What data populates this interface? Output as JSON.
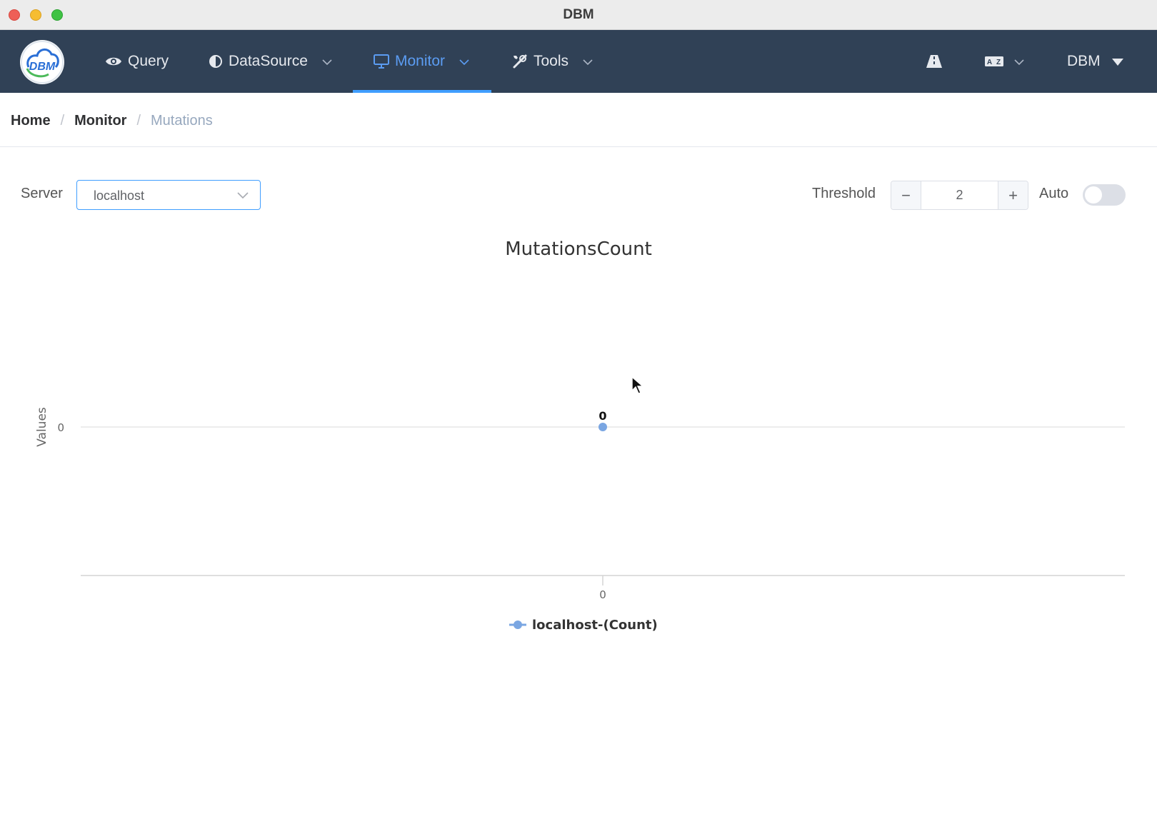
{
  "window": {
    "title": "DBM"
  },
  "nav": {
    "items": [
      {
        "label": "Query",
        "icon": "eye-icon"
      },
      {
        "label": "DataSource",
        "icon": "half-circle-icon"
      },
      {
        "label": "Monitor",
        "icon": "monitor-icon"
      },
      {
        "label": "Tools",
        "icon": "tools-icon"
      }
    ],
    "active": "Monitor",
    "logo_text": "DBM",
    "user_label": "DBM"
  },
  "breadcrumb": [
    "Home",
    "Monitor",
    "Mutations"
  ],
  "toolbar": {
    "server_label": "Server",
    "server_value": "localhost",
    "threshold_label": "Threshold",
    "threshold_value": "2",
    "minus": "−",
    "plus": "+",
    "auto_label": "Auto",
    "auto_on": false
  },
  "colors": {
    "accent": "#409eff",
    "navbar": "#304156",
    "series": "#7aa6e2"
  },
  "chart_data": {
    "type": "line",
    "title": "MutationsCount",
    "ylabel": "Values",
    "xlabel": "",
    "x": [
      "0"
    ],
    "series": [
      {
        "name": "localhost-(Count)",
        "values": [
          0
        ]
      }
    ],
    "y_ticks": [
      "0"
    ],
    "data_labels": true,
    "legend_position": "bottom"
  }
}
